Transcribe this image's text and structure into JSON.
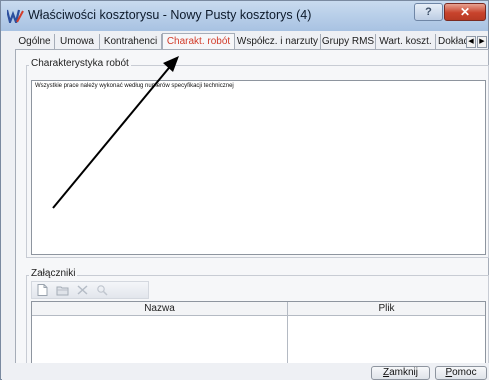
{
  "window": {
    "title": "Właściwości kosztorysu - Nowy  Pusty kosztorys (4)",
    "help_label": "?",
    "close_label": "✕"
  },
  "tabs": [
    {
      "label": "Ogólne"
    },
    {
      "label": "Umowa"
    },
    {
      "label": "Kontrahenci"
    },
    {
      "label": "Charakt. robót",
      "active": true
    },
    {
      "label": "Współcz. i narzuty"
    },
    {
      "label": "Grupy RMS"
    },
    {
      "label": "Wart. koszt."
    },
    {
      "label": "Dokładnoś"
    }
  ],
  "tab_scroll": {
    "left": "◀",
    "right": "▶"
  },
  "characteristics": {
    "group_label": "Charakterystyka robót",
    "text": "Wszystkie prace należy wykonać według numerów specyfikacji technicznej"
  },
  "attachments": {
    "group_label": "Załączniki",
    "toolbar": [
      "new-document-icon",
      "open-folder-icon",
      "delete-icon",
      "search-icon"
    ],
    "columns": [
      "Nazwa",
      "Plik"
    ],
    "rows": []
  },
  "buttons": {
    "close_first": "Z",
    "close_rest": "amknij",
    "help_first": "P",
    "help_rest": "omoc"
  },
  "colors": {
    "active_tab": "#d23c2a",
    "arrow": "#000000"
  }
}
